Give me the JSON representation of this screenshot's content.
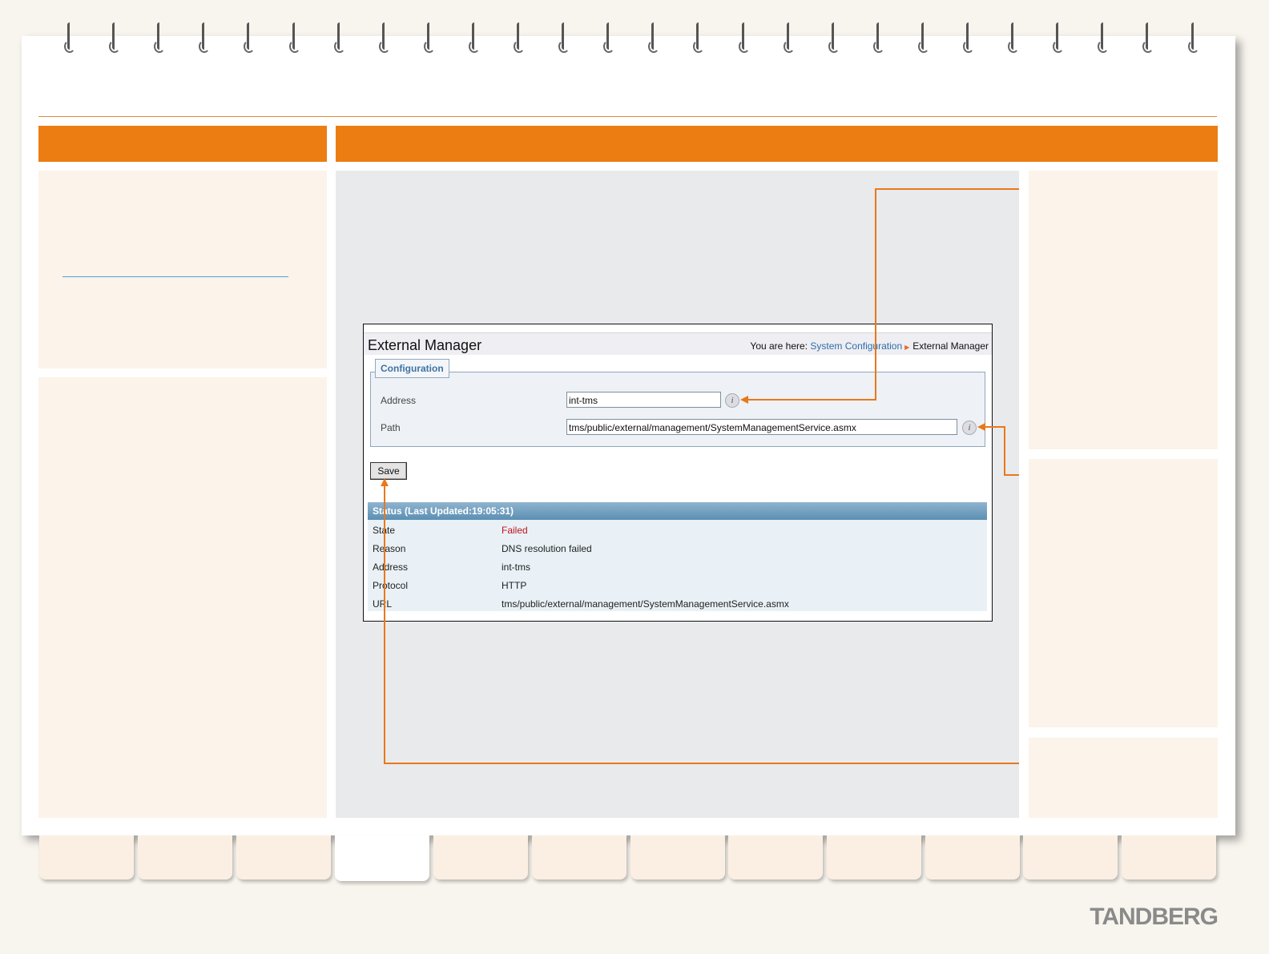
{
  "window": {
    "title": "External Manager",
    "breadcrumb_prefix": "You are here:",
    "breadcrumb_link": "System Configuration",
    "breadcrumb_current": "External Manager"
  },
  "configuration": {
    "legend": "Configuration",
    "address_label": "Address",
    "address_value": "int-tms",
    "path_label": "Path",
    "path_value": "tms/public/external/management/SystemManagementService.asmx",
    "info_glyph": "i"
  },
  "save_label": "Save",
  "status": {
    "header": "Status (Last Updated:19:05:31)",
    "rows": [
      {
        "label": "State",
        "value": "Failed"
      },
      {
        "label": "Reason",
        "value": "DNS resolution failed"
      },
      {
        "label": "Address",
        "value": "int-tms"
      },
      {
        "label": "Protocol",
        "value": "HTTP"
      },
      {
        "label": "URL",
        "value": "tms/public/external/management/SystemManagementService.asmx"
      }
    ]
  },
  "brand": {
    "logo": "TANDBERG",
    "accent": "#eb7d13",
    "state_failed_color": "#c0121c"
  }
}
